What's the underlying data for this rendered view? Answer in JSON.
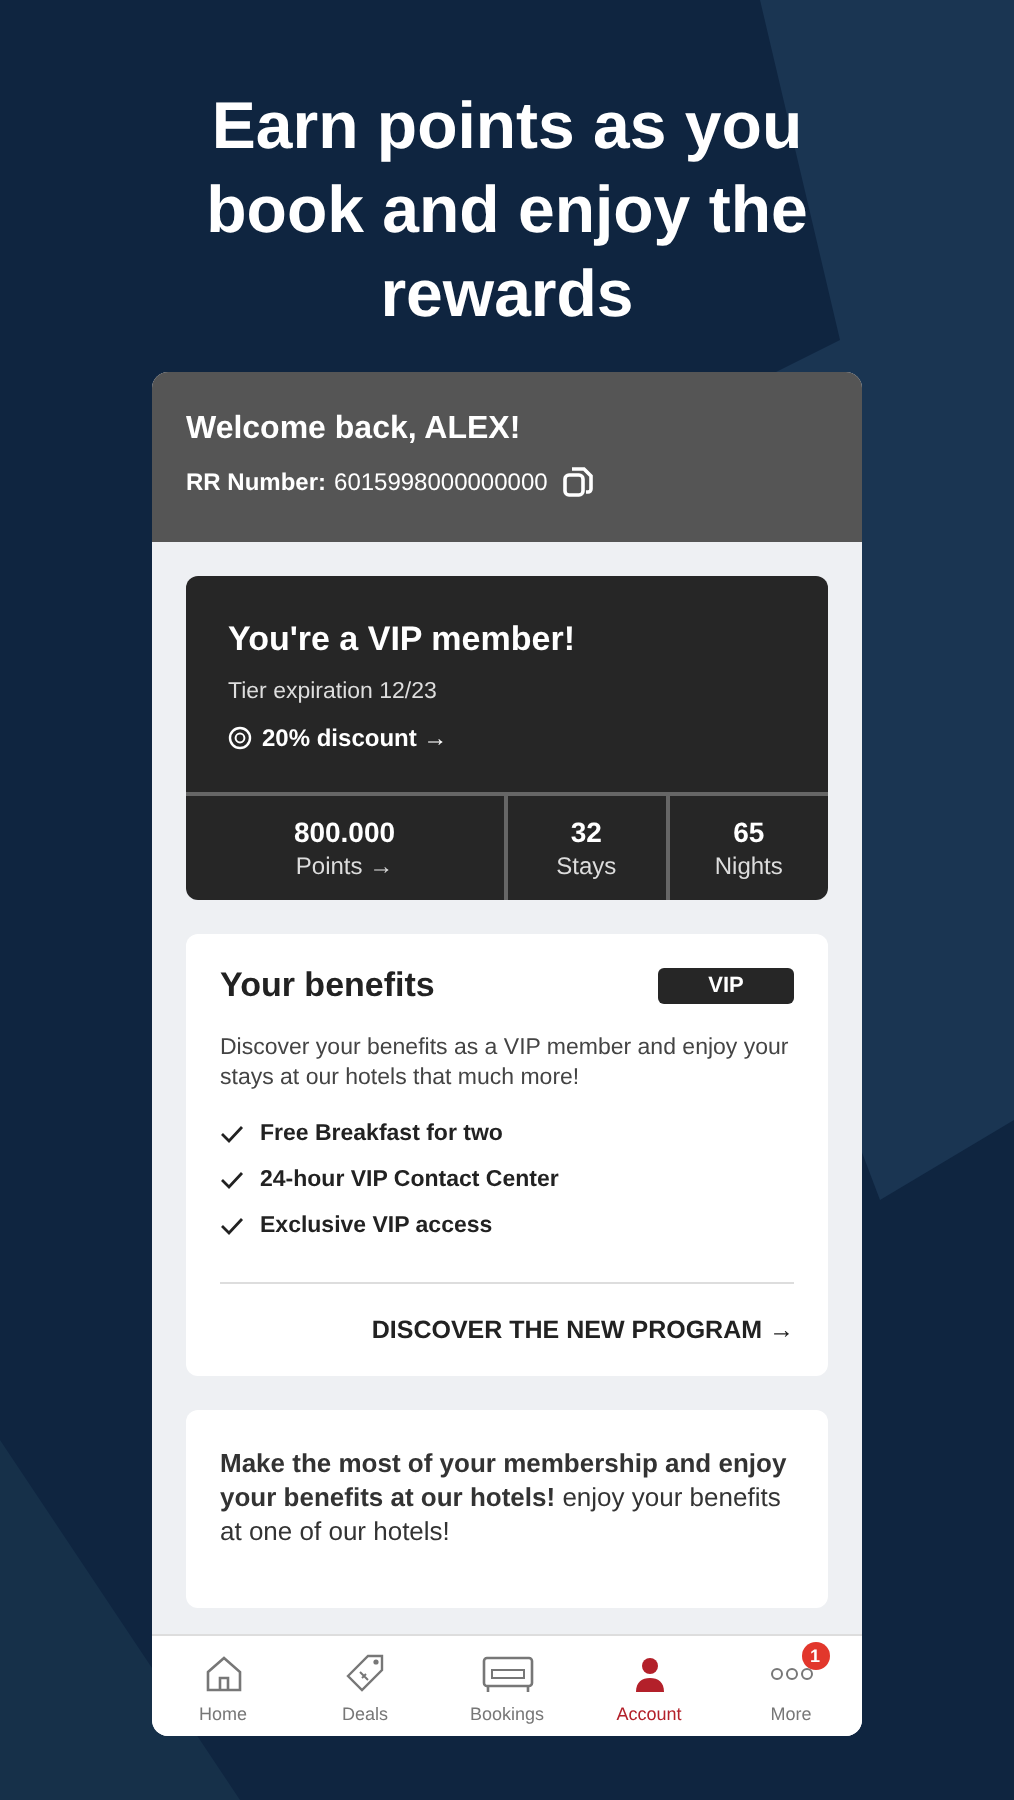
{
  "headline": "Earn points as you book and enjoy the rewards",
  "header": {
    "greeting": "Welcome back, ALEX!",
    "rr_label": "RR Number:",
    "rr_number": "6015998000000000"
  },
  "vip": {
    "title": "You're a VIP member!",
    "expiration": "Tier expiration 12/23",
    "discount": "20% discount →"
  },
  "stats": [
    {
      "value": "800.000",
      "label": "Points →"
    },
    {
      "value": "32",
      "label": "Stays"
    },
    {
      "value": "65",
      "label": "Nights"
    }
  ],
  "benefits": {
    "title": "Your benefits",
    "badge": "VIP",
    "description": "Discover your benefits as a VIP member and enjoy your stays at our hotels that much more!",
    "items": [
      "Free Breakfast for two",
      "24-hour VIP Contact Center",
      "Exclusive VIP access"
    ],
    "link": "DISCOVER THE NEW PROGRAM →"
  },
  "promo": {
    "text": "**Make the most of your membership and enjoy your benefits at our hotels!** enjoy your benefits at one of our hotels!"
  },
  "nav": [
    {
      "kind": "home",
      "label": "Home",
      "selected": false
    },
    {
      "kind": "deals",
      "label": "Deals",
      "selected": false
    },
    {
      "kind": "bookings",
      "label": "Bookings",
      "selected": false
    },
    {
      "kind": "account",
      "label": "Account",
      "selected": true
    },
    {
      "kind": "more",
      "label": "More",
      "selected": false,
      "badge": "1"
    }
  ]
}
